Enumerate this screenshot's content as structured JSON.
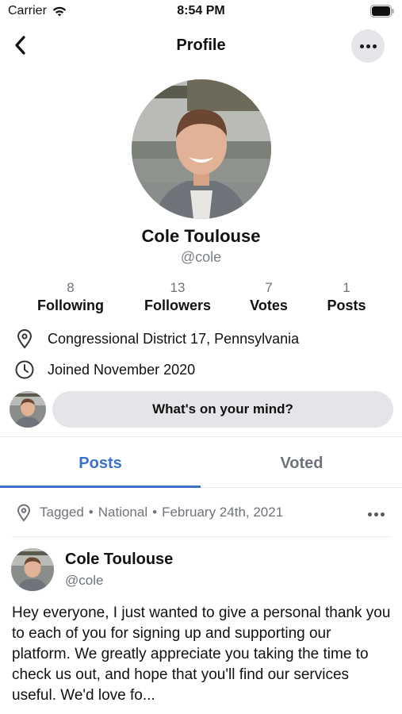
{
  "status_bar": {
    "carrier": "Carrier",
    "time": "8:54 PM"
  },
  "nav": {
    "title": "Profile",
    "back_icon": "chevron-left-icon",
    "more_icon": "ellipsis-icon"
  },
  "profile": {
    "name": "Cole Toulouse",
    "handle": "@cole",
    "stats": [
      {
        "value": "8",
        "label": "Following"
      },
      {
        "value": "13",
        "label": "Followers"
      },
      {
        "value": "7",
        "label": "Votes"
      },
      {
        "value": "1",
        "label": "Posts"
      }
    ],
    "location": "Congressional District 17, Pennsylvania",
    "joined": "Joined November 2020"
  },
  "composer": {
    "prompt": "What's on your mind?"
  },
  "tabs": [
    {
      "label": "Posts",
      "active": true
    },
    {
      "label": "Voted",
      "active": false
    }
  ],
  "post": {
    "tag": "Tagged",
    "scope": "National",
    "date": "February 24th, 2021",
    "author": "Cole Toulouse",
    "handle": "@cole",
    "body": "Hey everyone, I just wanted to give a personal thank you to each of you for signing up and supporting our platform. We greatly appreciate you taking the time to check us out, and hope that you'll find our services useful. We'd love fo..."
  },
  "colors": {
    "accent": "#3a72c9",
    "muted_text": "#6e737b",
    "pill_bg": "#e4e5e9"
  }
}
